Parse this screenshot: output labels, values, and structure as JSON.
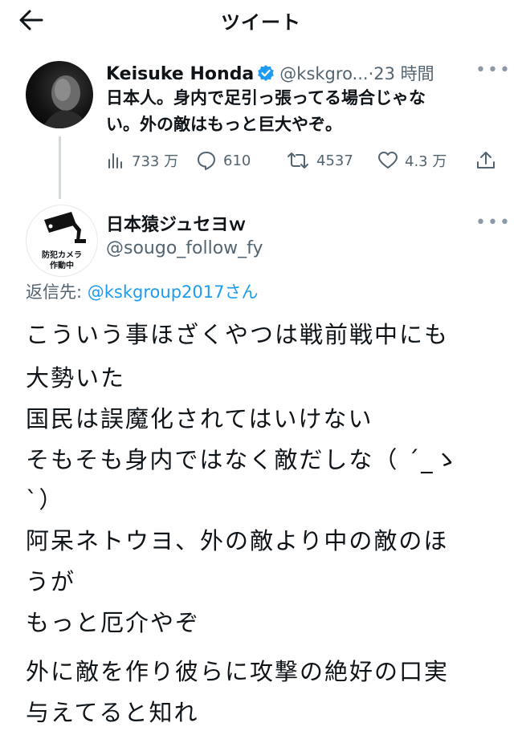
{
  "header": {
    "title": "ツイート",
    "back_icon": "arrow-left-icon"
  },
  "parent_tweet": {
    "name": "Keisuke Honda",
    "handle": "@kskgro...",
    "separator": "·",
    "time": "23 時間",
    "text_lines": [
      "日本人。身内で足引っ張ってる場合じゃな",
      "い。外の敵はもっと巨大やぞ。"
    ],
    "stats": {
      "views": "733 万",
      "replies": "610",
      "retweets": "4537",
      "likes": "4.3 万"
    },
    "verified_color": "#1d9bf0"
  },
  "reply_tweet": {
    "name": "日本猿ジュセヨｗ",
    "handle": "@sougo_follow_fy",
    "avatar_text": [
      "防犯カメラ",
      "作動中"
    ],
    "replying_label": "返信先:",
    "replying_to": "@kskgroup2017",
    "replying_suffix": "さん",
    "body_lines": [
      "こういう事ほざくやつは戦前戦中にも",
      "大勢いた",
      "国民は誤魔化されてはいけない",
      "そもそも身内ではなく敵だしな（ ´_ゝ",
      "`）",
      "阿呆ネトウヨ、外の敵より中の敵のほ",
      "うが",
      "もっと厄介やぞ",
      "外に敵を作り彼らに攻撃の絶好の口実",
      "与えてると知れ"
    ]
  },
  "colors": {
    "accent": "#1d9bf0",
    "secondary_text": "#536471",
    "text": "#0f1419"
  }
}
